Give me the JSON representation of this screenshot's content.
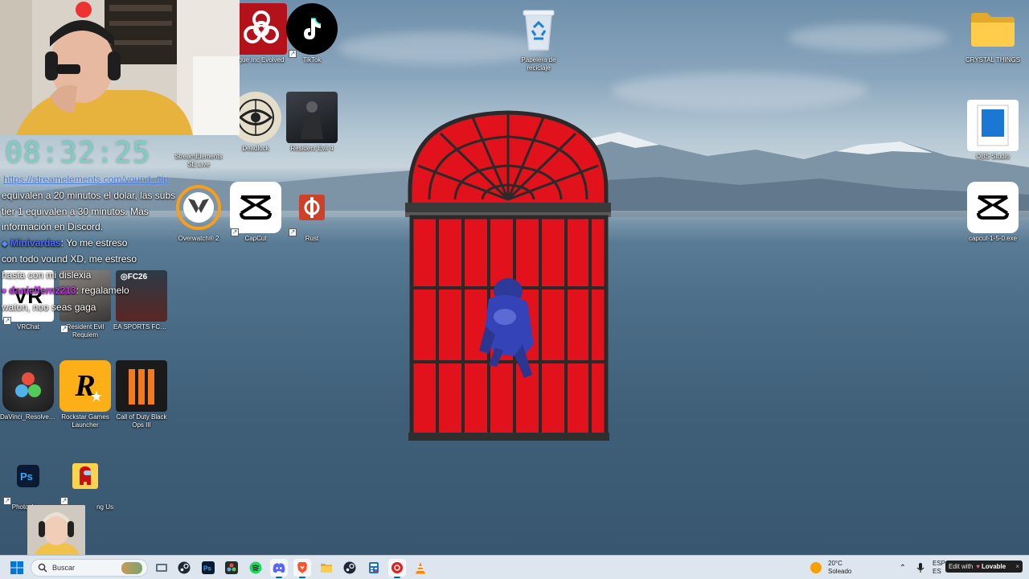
{
  "desktop": {
    "icons": [
      {
        "label": "Plague Inc Evolved",
        "display": "gue Inc Evolved"
      },
      {
        "label": "TikTok"
      },
      {
        "label": "Papelera de reciclaje"
      },
      {
        "label": "CRYSTAL THINGS"
      },
      {
        "label": "StreamElements SE.Live"
      },
      {
        "label": "Deadlock"
      },
      {
        "label": "Resident Evil 4"
      },
      {
        "label": "OBS Studio"
      },
      {
        "label": "Overwatch® 2"
      },
      {
        "label": "CapCut"
      },
      {
        "label": "Rust"
      },
      {
        "label": "capcut-1-5-0.exe"
      },
      {
        "label": "VRChat"
      },
      {
        "label": "Resident Evil Requiem"
      },
      {
        "label": "EA SPORTS FC™ 26"
      },
      {
        "label": "DaVinci_Resolve_..."
      },
      {
        "label": "Rockstar Games Launcher"
      },
      {
        "label": "Call of Duty Black Ops III"
      },
      {
        "label": "Photosho..."
      },
      {
        "label": "Among Us",
        "display": "ng Us"
      }
    ]
  },
  "overlay": {
    "clock": "08:32:25",
    "url": "https://streamelements.com/vound_/tip",
    "chat_lines": [
      {
        "text": "equivalen a 20 minutos el dolar, las subs"
      },
      {
        "text": "tier 1 equivalen a 30 minutos. Mas"
      },
      {
        "text": "información en Discord."
      },
      {
        "user": "Minivardas",
        "text": ": Yo me estreso"
      },
      {
        "text": "con todo vound XD, me estreso"
      },
      {
        "text": "hasta con mi dislexia"
      },
      {
        "user": "danielfernz213",
        "text": ": regalamelo"
      },
      {
        "text": "waton, noo seas gaga"
      }
    ]
  },
  "taskbar": {
    "search_placeholder": "Buscar",
    "apps": [
      "file-explorer",
      "steam",
      "photoshop",
      "davinci-resolve",
      "spotify",
      "discord",
      "brave",
      "folder",
      "steam",
      "calculator",
      "game",
      "vlc"
    ],
    "weather_temp": "20°C",
    "weather_desc": "Soleado",
    "lang_top": "ESP",
    "lang_bottom": "ES",
    "badge_edit": "Edit with",
    "badge_brand": "Lovable",
    "badge_close": "×"
  },
  "colors": {
    "window_red": "#e1121b",
    "window_frame": "#2a2a2a",
    "accent": "#0067c0"
  }
}
